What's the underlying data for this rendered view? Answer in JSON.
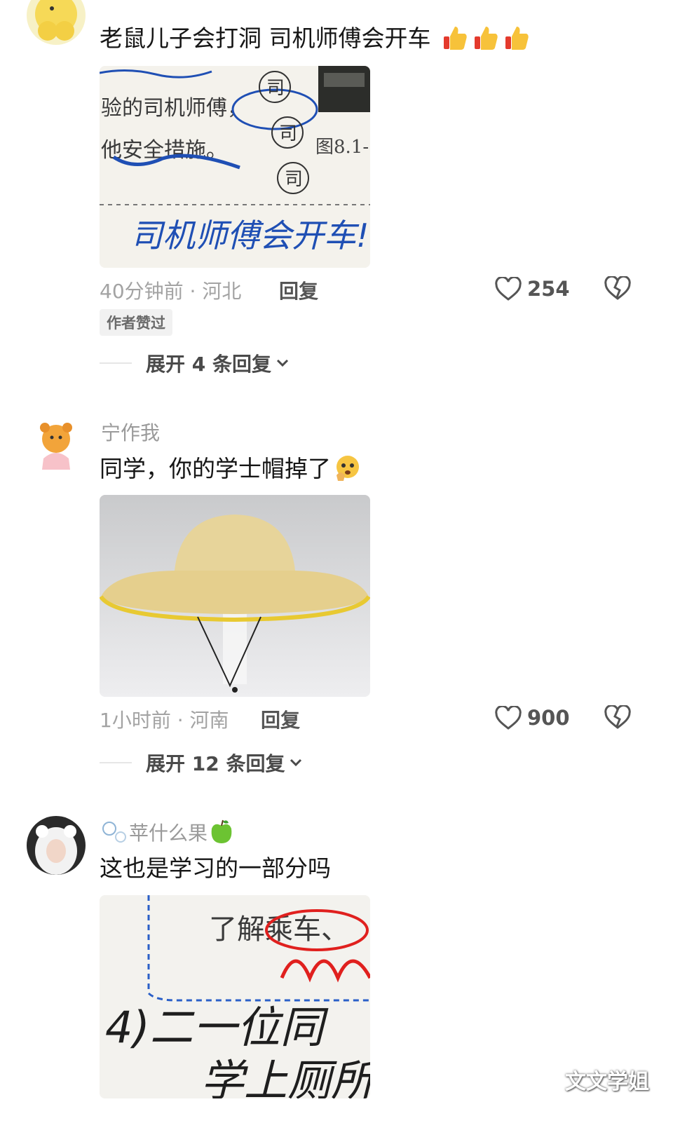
{
  "comments": [
    {
      "username": "",
      "text": "老鼠儿子会打洞 司机师傅会开车",
      "emoji": [
        "thumbs-up-icon",
        "thumbs-up-icon",
        "thumbs-up-icon"
      ],
      "image": {
        "type": "textbook-photo",
        "lines": [
          "验的司机师傅，",
          "他安全措施。",
          "司机师傅会开车!!!"
        ],
        "circled_chars": [
          "司",
          "司",
          "司"
        ],
        "figure_label": "图8.1-"
      },
      "time": "40分钟前",
      "location": "河北",
      "reply_label": "回复",
      "likes": "254",
      "badge": "作者赞过",
      "expand": "展开 4 条回复"
    },
    {
      "username": "宁作我",
      "text": "同学，你的学士帽掉了",
      "emoji": [
        "shocked-face-icon"
      ],
      "image": {
        "type": "straw-hat-photo"
      },
      "time": "1小时前",
      "location": "河南",
      "reply_label": "回复",
      "likes": "900",
      "expand": "展开 12 条回复"
    },
    {
      "username": "苹什么果",
      "username_icons": [
        "bubbles-icon",
        "green-apple-icon"
      ],
      "text": "这也是学习的一部分吗",
      "image": {
        "type": "textbook-photo",
        "lines": [
          "了解乘车、",
          "4)二一位同",
          "学上厕所"
        ]
      }
    }
  ],
  "watermark": "文文学姐",
  "colors": {
    "meta": "#a3a3a3",
    "text": "#161616",
    "ink_blue": "#1f4fb4",
    "ink_red": "#e0201e"
  }
}
